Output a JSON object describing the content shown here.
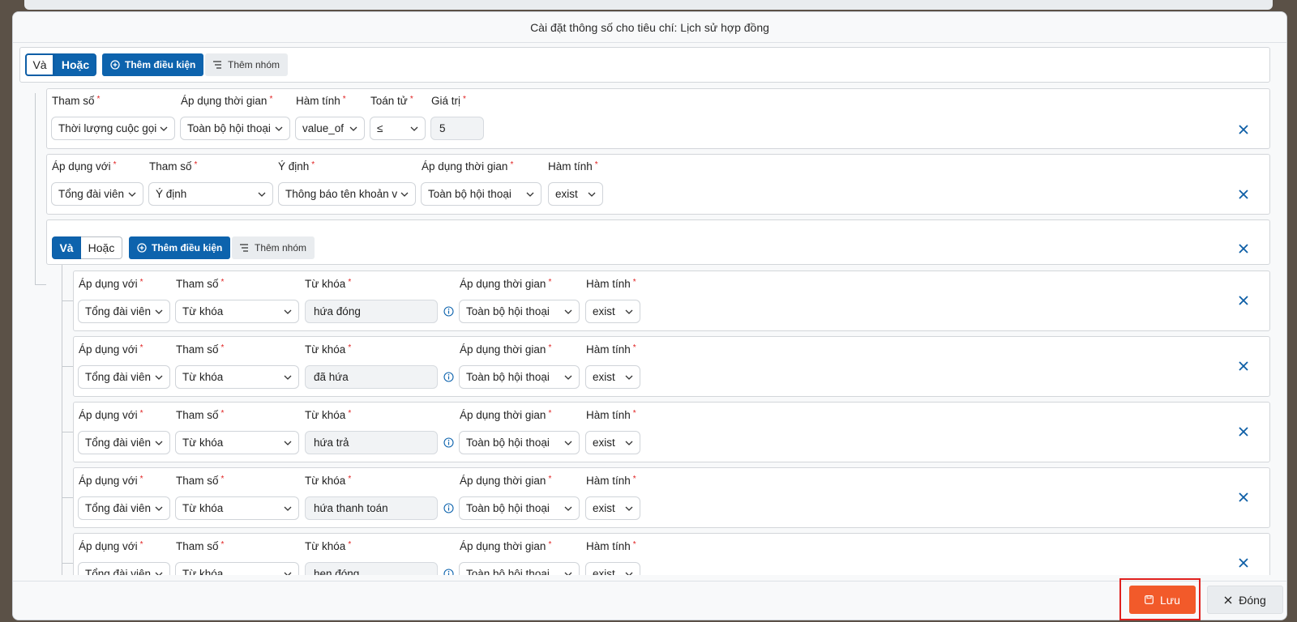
{
  "modal": {
    "title": "Cài đặt thông số cho tiêu chí: Lịch sử hợp đồng"
  },
  "root_group": {
    "and_label": "Và",
    "or_label": "Hoặc",
    "add_condition": "Thêm điều kiện",
    "add_group": "Thêm nhóm",
    "active": "or"
  },
  "cond1": {
    "labels": {
      "param": "Tham số",
      "time": "Áp dụng thời gian",
      "func": "Hàm tính",
      "op": "Toán tử",
      "value": "Giá trị"
    },
    "param": "Thời lượng cuộc gọi",
    "time": "Toàn bộ hội thoại",
    "func": "value_of",
    "op": "≤",
    "value": "5"
  },
  "cond2": {
    "labels": {
      "apply": "Áp dụng với",
      "param": "Tham số",
      "intent": "Ý định",
      "time": "Áp dụng thời gian",
      "func": "Hàm tính"
    },
    "apply": "Tổng đài viên",
    "param": "Ý định",
    "intent": "Thông báo tên khoản v",
    "time": "Toàn bộ hội thoại",
    "func": "exist"
  },
  "sub_group": {
    "and_label": "Và",
    "or_label": "Hoặc",
    "add_condition": "Thêm điều kiện",
    "add_group": "Thêm nhóm",
    "active": "and"
  },
  "keyword_labels": {
    "apply": "Áp dụng với",
    "param": "Tham số",
    "keyword": "Từ khóa",
    "time": "Áp dụng thời gian",
    "func": "Hàm tính"
  },
  "keyword_rows": [
    {
      "apply": "Tổng đài viên",
      "param": "Từ khóa",
      "keyword": "hứa đóng",
      "time": "Toàn bộ hội thoại",
      "func": "exist"
    },
    {
      "apply": "Tổng đài viên",
      "param": "Từ khóa",
      "keyword": "đã hứa",
      "time": "Toàn bộ hội thoại",
      "func": "exist"
    },
    {
      "apply": "Tổng đài viên",
      "param": "Từ khóa",
      "keyword": "hứa trả",
      "time": "Toàn bộ hội thoại",
      "func": "exist"
    },
    {
      "apply": "Tổng đài viên",
      "param": "Từ khóa",
      "keyword": "hứa thanh toán",
      "time": "Toàn bộ hội thoại",
      "func": "exist"
    },
    {
      "apply": "Tổng đài viên",
      "param": "Từ khóa",
      "keyword": "hẹn đóng",
      "time": "Toàn bộ hội thoại",
      "func": "exist"
    }
  ],
  "footer": {
    "save": "Lưu",
    "close": "Đóng"
  },
  "colors": {
    "primary": "#0d63ad",
    "save": "#f25a2a",
    "danger_highlight": "#e0201e"
  }
}
